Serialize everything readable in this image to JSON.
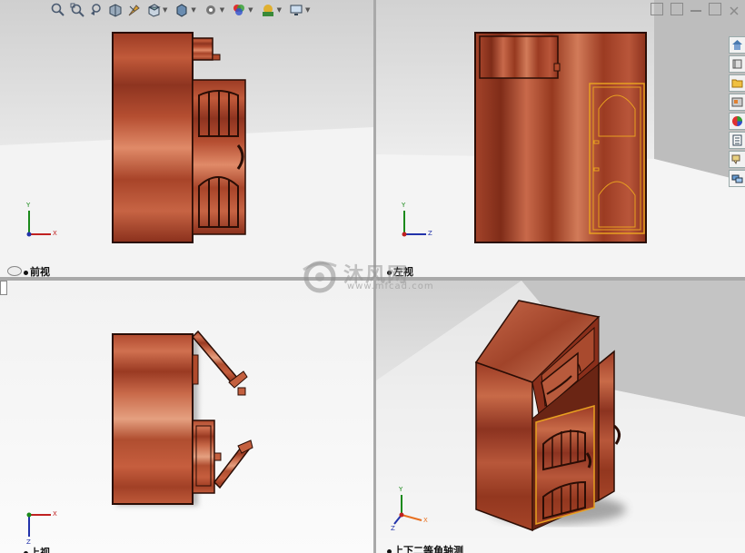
{
  "viewports": {
    "front": {
      "label": "前视"
    },
    "left": {
      "label": "左视"
    },
    "top": {
      "label": "上视"
    },
    "iso": {
      "label": "上下二等角轴测"
    }
  },
  "axes": {
    "x": "X",
    "y": "Y",
    "z": "Z"
  },
  "watermark": {
    "name": "沐风网",
    "url": "www.mfcad.com"
  },
  "toolbar": {
    "icons": [
      "zoom-to-fit-icon",
      "zoom-area-icon",
      "previous-view-icon",
      "section-view-icon",
      "dynamic-annotation-icon",
      "view-orientation-icon",
      "display-style-icon",
      "hide-show-icon",
      "edit-appearance-icon",
      "apply-scene-icon",
      "view-settings-icon"
    ]
  },
  "task_pane": {
    "icons": [
      "home-icon",
      "design-library-icon",
      "file-explorer-icon",
      "view-palette-icon",
      "appearances-icon",
      "custom-properties-icon",
      "forum-icon",
      "task-icon"
    ]
  },
  "colors": {
    "wood": "#a0402a",
    "wood_dark": "#5e1f10",
    "highlight": "#e8a020"
  }
}
